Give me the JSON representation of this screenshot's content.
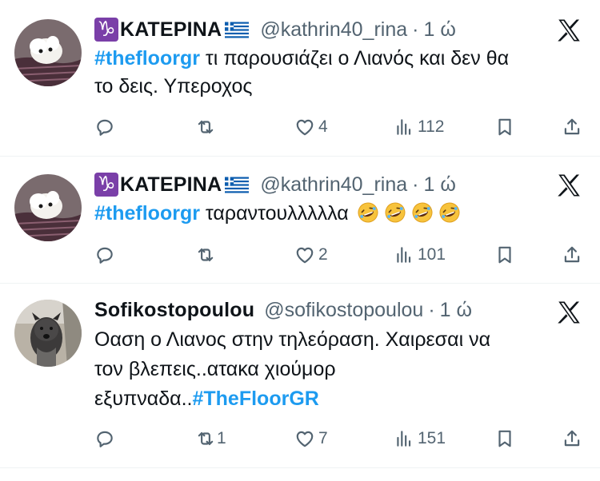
{
  "tweets": [
    {
      "name": "ΚΑΤΕΡΙΝΑ",
      "zodiac": "♑",
      "handle": "@kathrin40_rina",
      "time": "1 ώ",
      "hashtag": "#thefloorgr",
      "text_line1": " τι παρουσιάζει ο Λιανός και δεν θα",
      "text_line2": "το δεις. Υπεροχος",
      "replies": "",
      "reposts": "",
      "likes": "4",
      "views": "112",
      "avatar": "white-rabbit-avatar"
    },
    {
      "name": "ΚΑΤΕΡΙΝΑ",
      "zodiac": "♑",
      "handle": "@kathrin40_rina",
      "time": "1 ώ",
      "hashtag": "#thefloorgr",
      "text_line1": " ταραντουλλλλλα",
      "emoji": "rolling-on-floor-laughing-emoji",
      "emoji_count": 4,
      "replies": "",
      "reposts": "",
      "likes": "2",
      "views": "101",
      "avatar": "white-rabbit-avatar"
    },
    {
      "name": "Sofikostopoulou",
      "handle": "@sofikostopoulou",
      "time": "1 ώ",
      "text_line1": "Οαση ο Λιανος στην τηλεόραση.  Χαιρεσαι να",
      "text_line2": "τον  βλεπεις..ατακα χιούμορ",
      "text_line3": "εξυπναδα..",
      "hashtag": "#TheFloorGR",
      "replies": "",
      "reposts": "1",
      "likes": "7",
      "views": "151",
      "avatar": "dog-avatar"
    }
  ],
  "colors": {
    "accent": "#1d9bf0",
    "muted": "#536471",
    "text": "#0f1419",
    "divider": "#eff3f4"
  }
}
